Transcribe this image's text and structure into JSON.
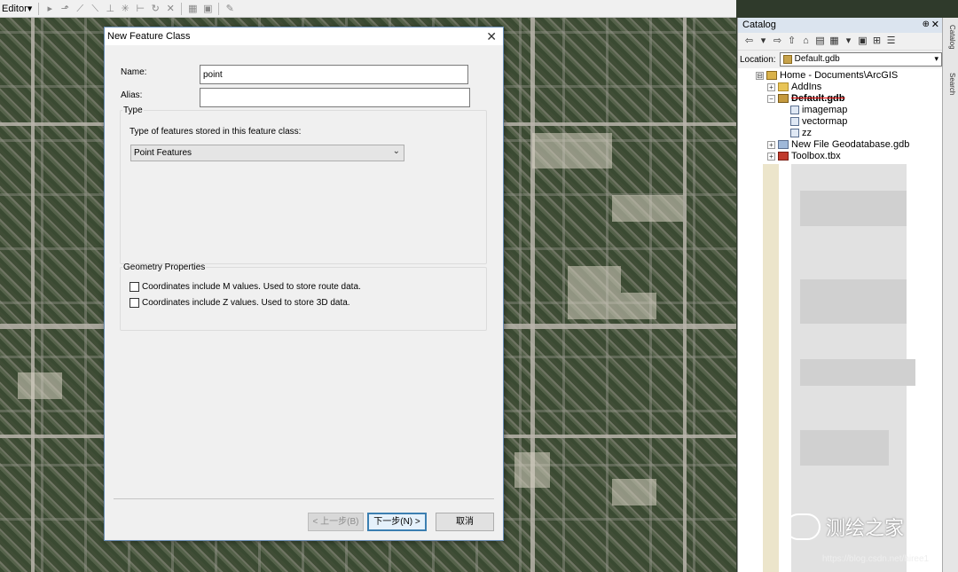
{
  "toolbar": {
    "editor_label": "Editor▾",
    "icons": [
      "pointer-icon",
      "edit-vertices-icon",
      "sketch-icon",
      "straight-segment-icon",
      "midpoint-icon",
      "cut-polygons-icon",
      "split-icon",
      "rotate-icon",
      "attributes-icon",
      "sketch-properties-icon",
      "create-features-icon",
      "options-icon"
    ]
  },
  "dialog": {
    "title": "New Feature Class",
    "close_glyph": "✕",
    "name_label": "Name:",
    "name_value": "point",
    "alias_label": "Alias:",
    "alias_value": "",
    "type_group": {
      "legend": "Type",
      "prompt": "Type of features stored in this feature class:",
      "selected": "Point Features"
    },
    "geometry_group": {
      "legend": "Geometry Properties",
      "m_values": "Coordinates include M values. Used to store route data.",
      "z_values": "Coordinates include Z values. Used to store 3D data."
    },
    "buttons": {
      "back": "< 上一步(B)",
      "next": "下一步(N) >",
      "cancel": "取消"
    }
  },
  "catalog": {
    "title": "Catalog",
    "pin_glyph": "⊕",
    "close_glyph": "✕",
    "location_label": "Location:",
    "location_value": "Default.gdb",
    "tree": [
      {
        "label": "Home - Documents\\ArcGIS",
        "level": 0,
        "expander": "⊟",
        "icon": "home"
      },
      {
        "label": "AddIns",
        "level": 1,
        "expander": "+",
        "icon": "folder"
      },
      {
        "label": "Default.gdb",
        "level": 1,
        "expander": "−",
        "icon": "gdb",
        "selected": true
      },
      {
        "label": "imagemap",
        "level": 2,
        "expander": "",
        "icon": "fc"
      },
      {
        "label": "vectormap",
        "level": 2,
        "expander": "",
        "icon": "fc"
      },
      {
        "label": "zz",
        "level": 2,
        "expander": "",
        "icon": "fc"
      },
      {
        "label": "New File Geodatabase.gdb",
        "level": 1,
        "expander": "+",
        "icon": "fgdb"
      },
      {
        "label": "Toolbox.tbx",
        "level": 1,
        "expander": "+",
        "icon": "tbx"
      }
    ]
  },
  "side_tabs": {
    "catalog": "Catalog",
    "search": "Search"
  },
  "watermark": {
    "text": "测绘之家",
    "url": "https://blog.csdn.net/hiree1"
  }
}
